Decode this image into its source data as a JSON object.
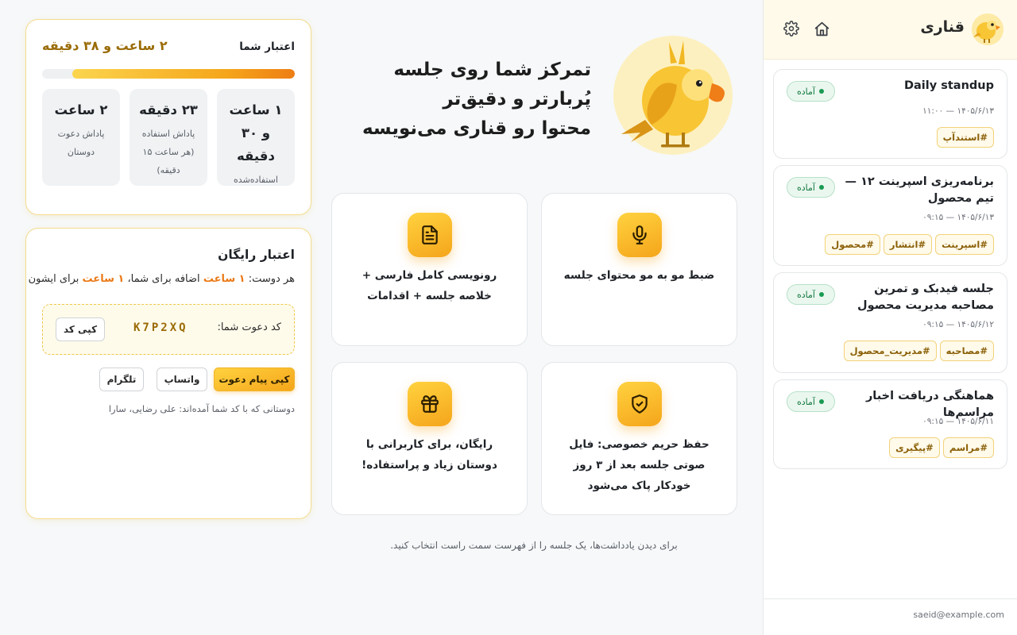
{
  "sidebar": {
    "brand": "قناری",
    "header_icons": [
      "home-icon",
      "gear-icon"
    ],
    "sessions": [
      {
        "title": "Daily standup",
        "status": "آماده",
        "date": "۱۴۰۵/۶/۱۳ — ۱۱:۰۰",
        "tags": [
          "#استندآپ"
        ]
      },
      {
        "title": "برنامه‌ریزی اسپرینت ۱۲ — تیم محصول",
        "status": "آماده",
        "date": "۱۴۰۵/۶/۱۳ — ۰۹:۱۵",
        "tags": [
          "#اسپرینت",
          "#انتشار",
          "#محصول"
        ]
      },
      {
        "title": "جلسه فیدبک و تمرین مصاحبه مدیریت محصول",
        "status": "آماده",
        "date": "۱۴۰۵/۶/۱۲ — ۰۹:۱۵",
        "tags": [
          "#مصاحبه",
          "#مدیریت_محصول"
        ]
      },
      {
        "title": "هماهنگی دریافت اخبار مراسم‌ها",
        "status": "آماده",
        "date": "۱۴۰۵/۶/۱۱ — ۰۹:۱۵",
        "tags": [
          "#مراسم",
          "#پیگیری"
        ]
      }
    ],
    "user_email": "saeid@example.com"
  },
  "hero": {
    "line1": "تمرکز شما روی جلسه پُربارتر و دقیق‌تر",
    "line2": "محتوا رو قناری می‌نویسه"
  },
  "features": [
    {
      "icon": "microphone-icon",
      "text": "ضبط مو به مو محتوای جلسه"
    },
    {
      "icon": "document-icon",
      "text": "رونویسی کامل فارسی + خلاصه جلسه + اقدامات"
    },
    {
      "icon": "shield-check-icon",
      "text": "حفظ حریم خصوصی: فایل صوتی جلسه بعد از ۳ روز خودکار پاک می‌شود"
    },
    {
      "icon": "gift-icon",
      "text": "رایگان، برای کاربرانی با دوستان زیاد و پراستفاده!"
    }
  ],
  "hint": "برای دیدن یادداشت‌ها، یک جلسه را از فهرست سمت راست انتخاب کنید.",
  "credit": {
    "label": "اعتبار شما",
    "total": "۲ ساعت و ۳۸ دقیقه",
    "progress_remaining_fraction": 0.88,
    "stats": [
      {
        "value": "۱ ساعت و ۳۰ دقیقه",
        "label": "استفاده‌شده"
      },
      {
        "value": "۲۳ دقیقه",
        "label": "پاداش استفاده (هر ساعت ۱۵ دقیقه)"
      },
      {
        "value": "۲ ساعت",
        "label": "پاداش دعوت دوستان"
      }
    ]
  },
  "free_credit": {
    "title": "اعتبار رایگان",
    "desc_prefix": "هر دوست:",
    "desc_amount1": "۱ ساعت",
    "desc_mid": "اضافه برای شما،",
    "desc_amount2": "۱ ساعت",
    "desc_suffix": "برای ایشون",
    "invite_label": "کد دعوت شما:",
    "invite_code": "K7P2XQ",
    "copy_code_label": "کپی کد",
    "copy_message_label": "کپی پیام دعوت",
    "whatsapp_label": "واتساپ",
    "telegram_label": "تلگرام",
    "friends_text": "دوستانی که با کد شما آمده‌اند: علی رضایی، سارا"
  },
  "colors": {
    "accent": "#f5a51a",
    "accent_light": "#ffd23f",
    "ready_badge": "#1a9a52",
    "tag_text": "#8a5f06"
  }
}
